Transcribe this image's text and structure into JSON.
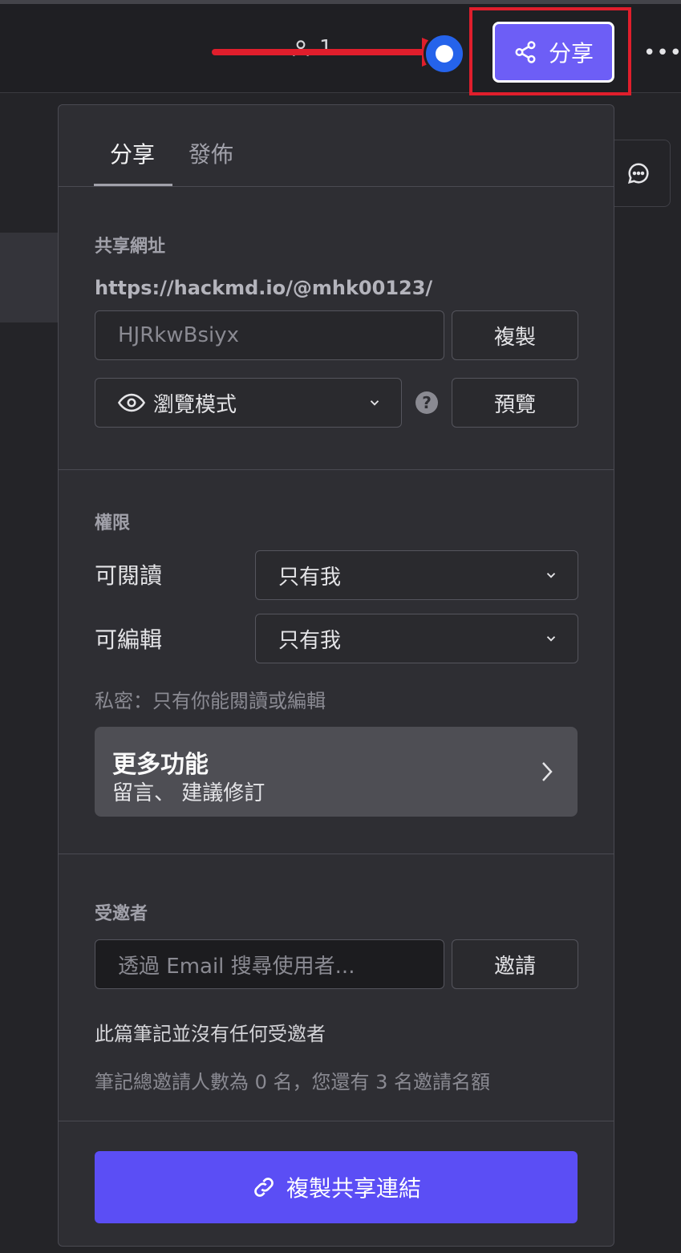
{
  "topbar": {
    "presence_count": "1",
    "share_label": "分享",
    "more_label": "•••"
  },
  "panel": {
    "tabs": [
      {
        "label": "分享",
        "active": true
      },
      {
        "label": "發佈",
        "active": false
      }
    ],
    "share_url": {
      "title": "共享網址",
      "base_url": "https://hackmd.io/@mhk00123/",
      "slug_placeholder": "HJRkwBsiyx",
      "copy_label": "複製",
      "mode_label": "瀏覽模式",
      "help_label": "?",
      "preview_label": "預覽"
    },
    "permissions": {
      "title": "權限",
      "read_label": "可閱讀",
      "read_value": "只有我",
      "edit_label": "可編輯",
      "edit_value": "只有我",
      "note": "私密：只有你能閱讀或編輯",
      "more_title": "更多功能",
      "more_subtitle": "留言、 建議修訂"
    },
    "invitees": {
      "title": "受邀者",
      "search_placeholder": "透過 Email 搜尋使用者...",
      "invite_label": "邀請",
      "empty_text": "此篇筆記並沒有任何受邀者",
      "quota_text": "筆記總邀請人數為 0 名，您還有 3 名邀請名額"
    },
    "copy_link_label": "複製共享連結"
  },
  "colors": {
    "accent": "#6d5ef6",
    "primary_button": "#5b4ef5",
    "highlight": "#e01e2c"
  }
}
